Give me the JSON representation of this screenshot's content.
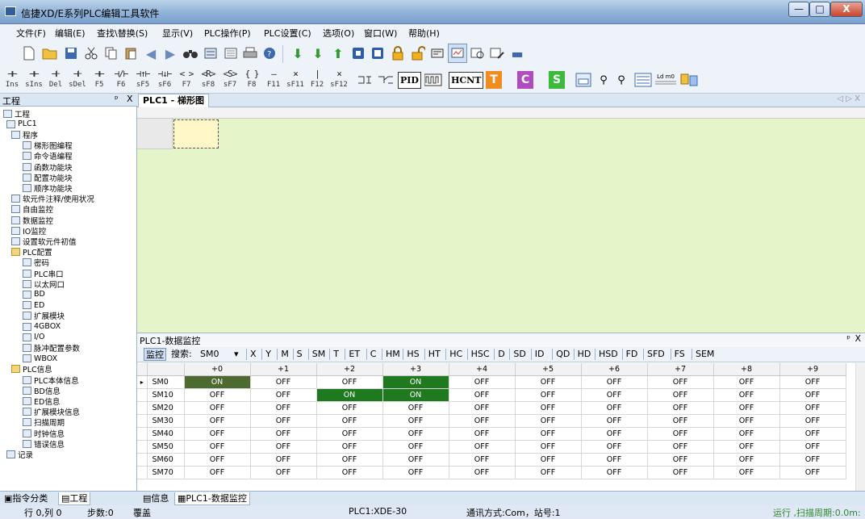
{
  "window": {
    "title": "信捷XD/E系列PLC编辑工具软件",
    "minimize": "—",
    "maximize": "□",
    "close": "X"
  },
  "menu": [
    "文件(F)",
    "编辑(E)",
    "查找\\替换(S)",
    "显示(V)",
    "PLC操作(P)",
    "PLC设置(C)",
    "选项(O)",
    "窗口(W)",
    "帮助(H)"
  ],
  "toolbar2": {
    "keys": [
      {
        "g": "⊣⊢",
        "k": "Ins"
      },
      {
        "g": "⊣⊢",
        "k": "sIns"
      },
      {
        "g": "⊣⊦",
        "k": "Del"
      },
      {
        "g": "⊣⊦",
        "k": "sDel"
      },
      {
        "g": "⊣⊢",
        "k": "F5"
      },
      {
        "g": "⊣/⊢",
        "k": "F6"
      },
      {
        "g": "⊣↑⊢",
        "k": "sF5"
      },
      {
        "g": "⊣↓⊢",
        "k": "sF6"
      },
      {
        "g": "< >",
        "k": "F7"
      },
      {
        "g": "<R>",
        "k": "sF8"
      },
      {
        "g": "<S>",
        "k": "sF7"
      },
      {
        "g": "{ }",
        "k": "F8"
      },
      {
        "g": "—",
        "k": "F11"
      },
      {
        "g": "⨯",
        "k": "sF11"
      },
      {
        "g": "|",
        "k": "F12"
      },
      {
        "g": "⨯",
        "k": "sF12"
      }
    ],
    "pid": "PID",
    "hcnt": "HCNT",
    "t": "T",
    "c": "C",
    "s": "S",
    "ldm0": "Ld m0"
  },
  "left_panel": {
    "title": "工程",
    "pin": "ᵖ",
    "close": "X",
    "tree": [
      {
        "label": "工程",
        "icon": "project-icon",
        "level": 0,
        "folder": false
      },
      {
        "label": "PLC1",
        "icon": "plc-icon",
        "level": 1,
        "folder": false
      },
      {
        "label": "程序",
        "icon": "program-icon",
        "level": 2,
        "folder": false
      },
      {
        "label": "梯形图编程",
        "icon": "ladder-icon",
        "level": 3,
        "folder": false
      },
      {
        "label": "命令语编程",
        "icon": "instruction-icon",
        "level": 3,
        "folder": false
      },
      {
        "label": "函数功能块",
        "icon": "function-block-icon",
        "level": 3,
        "folder": false
      },
      {
        "label": "配置功能块",
        "icon": "config-block-icon",
        "level": 3,
        "folder": false
      },
      {
        "label": "顺序功能块",
        "icon": "sequence-block-icon",
        "level": 3,
        "folder": false
      },
      {
        "label": "软元件注释/使用状况",
        "icon": "comment-icon",
        "level": 2,
        "folder": false
      },
      {
        "label": "自由监控",
        "icon": "monitor-icon",
        "level": 2,
        "folder": false
      },
      {
        "label": "数据监控",
        "icon": "data-monitor-icon",
        "level": 2,
        "folder": false
      },
      {
        "label": "IO监控",
        "icon": "io-monitor-icon",
        "level": 2,
        "folder": false
      },
      {
        "label": "设置软元件初值",
        "icon": "init-value-icon",
        "level": 2,
        "folder": false
      },
      {
        "label": "PLC配置",
        "icon": "folder-icon",
        "level": 2,
        "folder": true
      },
      {
        "label": "密码",
        "icon": "password-icon",
        "level": 3,
        "folder": false
      },
      {
        "label": "PLC串口",
        "icon": "serial-port-icon",
        "level": 3,
        "folder": false
      },
      {
        "label": "以太网口",
        "icon": "ethernet-icon",
        "level": 3,
        "folder": false
      },
      {
        "label": "BD",
        "icon": "bd-icon",
        "level": 3,
        "folder": false
      },
      {
        "label": "ED",
        "icon": "ed-icon",
        "level": 3,
        "folder": false
      },
      {
        "label": "扩展模块",
        "icon": "expansion-icon",
        "level": 3,
        "folder": false
      },
      {
        "label": "4GBOX",
        "icon": "4gbox-icon",
        "level": 3,
        "folder": false
      },
      {
        "label": "I/O",
        "icon": "io-icon",
        "level": 3,
        "folder": false
      },
      {
        "label": "脉冲配置参数",
        "icon": "pulse-icon",
        "level": 3,
        "folder": false
      },
      {
        "label": "WBOX",
        "icon": "wbox-icon",
        "level": 3,
        "folder": false
      },
      {
        "label": "PLC信息",
        "icon": "folder-icon",
        "level": 2,
        "folder": true
      },
      {
        "label": "PLC本体信息",
        "icon": "plc-info-icon",
        "level": 3,
        "folder": false
      },
      {
        "label": "BD信息",
        "icon": "bd-info-icon",
        "level": 3,
        "folder": false
      },
      {
        "label": "ED信息",
        "icon": "ed-info-icon",
        "level": 3,
        "folder": false
      },
      {
        "label": "扩展模块信息",
        "icon": "expansion-info-icon",
        "level": 3,
        "folder": false
      },
      {
        "label": "扫描周期",
        "icon": "scan-cycle-icon",
        "level": 3,
        "folder": false
      },
      {
        "label": "时钟信息",
        "icon": "clock-icon",
        "level": 3,
        "folder": false
      },
      {
        "label": "错误信息",
        "icon": "error-icon",
        "level": 3,
        "folder": false
      },
      {
        "label": "记录",
        "icon": "record-icon",
        "level": 1,
        "folder": false
      }
    ],
    "bottom_tabs": [
      "指令分类",
      "工程"
    ]
  },
  "editor": {
    "tab": "PLC1 - 梯形图",
    "arrows": "◁ ▷ X"
  },
  "monitor": {
    "title": "PLC1-数据监控",
    "pin": "ᵖ",
    "close": "X",
    "toolbar": {
      "monitor_btn": "监控",
      "search_label": "搜索:",
      "search_value": "SM0",
      "dropdown": "▾",
      "types": [
        "X",
        "Y",
        "M",
        "S",
        "SM",
        "T",
        "ET",
        "C",
        "HM",
        "HS",
        "HT",
        "HC",
        "HSC",
        "D",
        "SD",
        "ID",
        "QD",
        "HD",
        "HSD",
        "FD",
        "SFD",
        "FS",
        "SEM"
      ]
    },
    "columns": [
      "+0",
      "+1",
      "+2",
      "+3",
      "+4",
      "+5",
      "+6",
      "+7",
      "+8",
      "+9"
    ],
    "rows": [
      {
        "name": "SM0",
        "values": [
          "ON",
          "OFF",
          "OFF",
          "ON",
          "OFF",
          "OFF",
          "OFF",
          "OFF",
          "OFF",
          "OFF"
        ]
      },
      {
        "name": "SM10",
        "values": [
          "OFF",
          "OFF",
          "ON",
          "ON",
          "OFF",
          "OFF",
          "OFF",
          "OFF",
          "OFF",
          "OFF"
        ]
      },
      {
        "name": "SM20",
        "values": [
          "OFF",
          "OFF",
          "OFF",
          "OFF",
          "OFF",
          "OFF",
          "OFF",
          "OFF",
          "OFF",
          "OFF"
        ]
      },
      {
        "name": "SM30",
        "values": [
          "OFF",
          "OFF",
          "OFF",
          "OFF",
          "OFF",
          "OFF",
          "OFF",
          "OFF",
          "OFF",
          "OFF"
        ]
      },
      {
        "name": "SM40",
        "values": [
          "OFF",
          "OFF",
          "OFF",
          "OFF",
          "OFF",
          "OFF",
          "OFF",
          "OFF",
          "OFF",
          "OFF"
        ]
      },
      {
        "name": "SM50",
        "values": [
          "OFF",
          "OFF",
          "OFF",
          "OFF",
          "OFF",
          "OFF",
          "OFF",
          "OFF",
          "OFF",
          "OFF"
        ]
      },
      {
        "name": "SM60",
        "values": [
          "OFF",
          "OFF",
          "OFF",
          "OFF",
          "OFF",
          "OFF",
          "OFF",
          "OFF",
          "OFF",
          "OFF"
        ]
      },
      {
        "name": "SM70",
        "values": [
          "OFF",
          "OFF",
          "OFF",
          "OFF",
          "OFF",
          "OFF",
          "OFF",
          "OFF",
          "OFF",
          "OFF"
        ]
      }
    ],
    "row_pointer": "▸",
    "bottom_tabs": [
      "信息",
      "PLC1-数据监控"
    ]
  },
  "status": {
    "position": "行 0,列 0",
    "steps": "步数:0",
    "mode": "覆盖",
    "model": "PLC1:XDE-30",
    "comm": "通讯方式:Com，站号:1",
    "run": "运行 ,扫描周期:0.0m:"
  },
  "colors": {
    "ladder_bg": "#e6f5c9",
    "on_cell": "#1f7a1f",
    "title_gradient": "#8fb2d8"
  }
}
